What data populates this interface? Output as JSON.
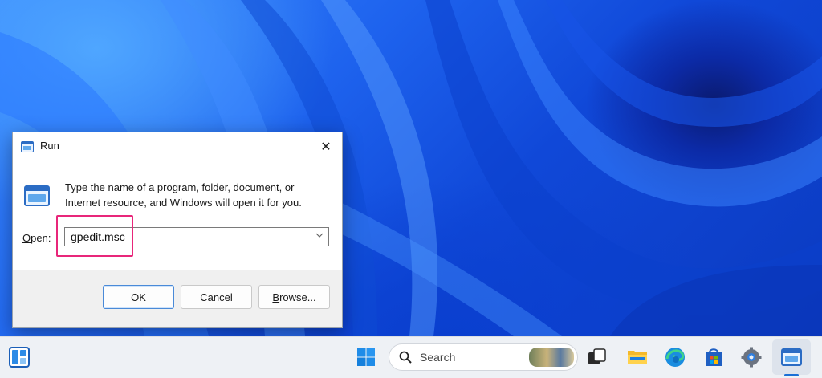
{
  "desktop": {
    "wallpaper": "windows-11-bloom-blue"
  },
  "run_dialog": {
    "title": "Run",
    "close_glyph": "✕",
    "description": "Type the name of a program, folder, document, or Internet resource, and Windows will open it for you.",
    "open_label_accel": "O",
    "open_label_rest": "pen:",
    "open_value": "gpedit.msc",
    "highlight_color": "#e8267a",
    "buttons": {
      "ok": "OK",
      "cancel": "Cancel",
      "browse_accel": "B",
      "browse_rest": "rowse..."
    }
  },
  "taskbar": {
    "search_label": "Search",
    "icons": [
      "widgets-icon",
      "start-icon",
      "search-icon",
      "task-view-icon",
      "file-explorer-icon",
      "edge-icon",
      "microsoft-store-icon",
      "settings-icon",
      "run-icon"
    ],
    "accent": "#1a6fd6"
  }
}
